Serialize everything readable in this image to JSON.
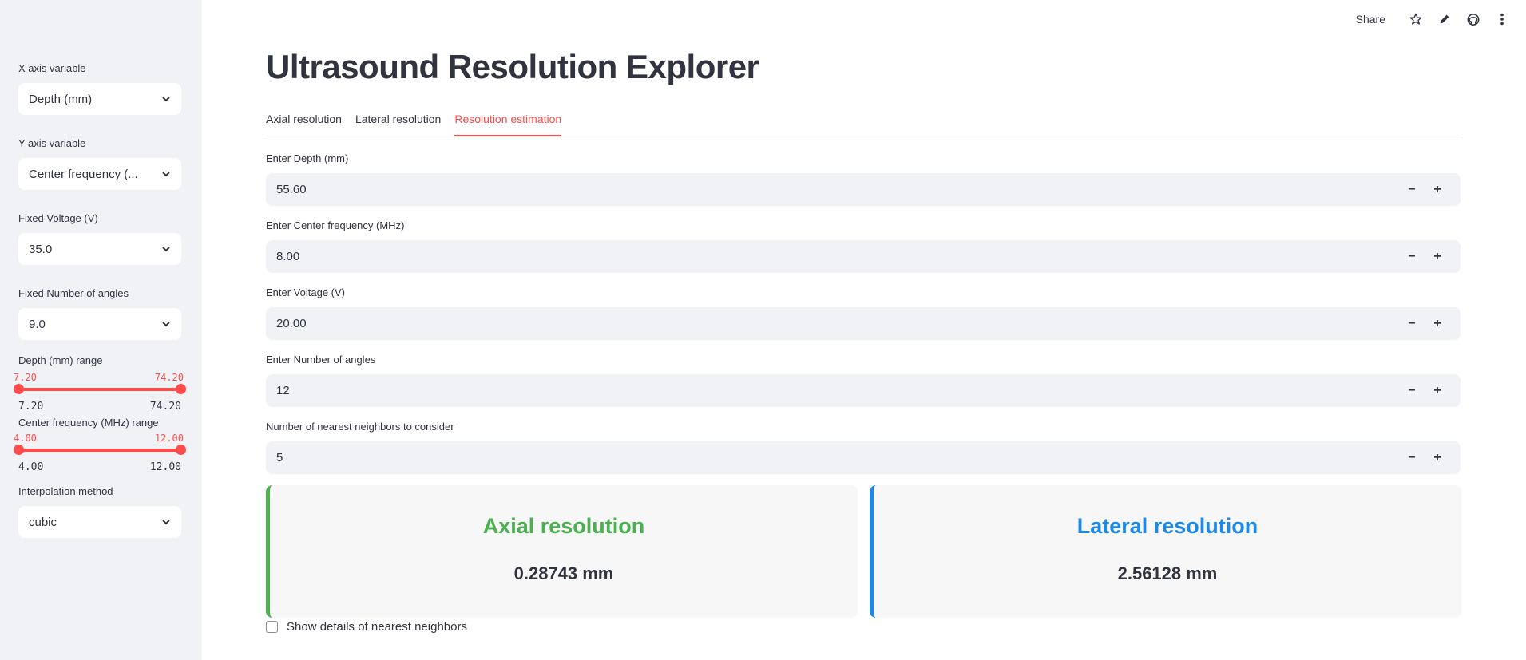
{
  "sidebar": {
    "x_axis": {
      "label": "X axis variable",
      "value": "Depth (mm)"
    },
    "y_axis": {
      "label": "Y axis variable",
      "value": "Center frequency (..."
    },
    "fixed_voltage": {
      "label": "Fixed Voltage (V)",
      "value": "35.0"
    },
    "fixed_angles": {
      "label": "Fixed Number of angles",
      "value": "9.0"
    },
    "depth_range": {
      "label": "Depth (mm) range",
      "low": "7.20",
      "high": "74.20",
      "min": "7.20",
      "max": "74.20"
    },
    "freq_range": {
      "label": "Center frequency (MHz) range",
      "low": "4.00",
      "high": "12.00",
      "min": "4.00",
      "max": "12.00"
    },
    "interp": {
      "label": "Interpolation method",
      "value": "cubic"
    }
  },
  "header": {
    "share_label": "Share",
    "icons": [
      "star-icon",
      "edit-icon",
      "github-icon",
      "more-vertical-icon"
    ]
  },
  "main": {
    "title": "Ultrasound Resolution Explorer",
    "tabs": [
      {
        "label": "Axial resolution",
        "active": false
      },
      {
        "label": "Lateral resolution",
        "active": false
      },
      {
        "label": "Resolution estimation",
        "active": true
      }
    ],
    "fields": [
      {
        "label": "Enter Depth (mm)",
        "value": "55.60"
      },
      {
        "label": "Enter Center frequency (MHz)",
        "value": "8.00"
      },
      {
        "label": "Enter Voltage (V)",
        "value": "20.00"
      },
      {
        "label": "Enter Number of angles",
        "value": "12"
      },
      {
        "label": "Number of nearest neighbors to consider",
        "value": "5"
      }
    ],
    "step_minus": "−",
    "step_plus": "+",
    "results": {
      "axial": {
        "title": "Axial resolution",
        "value": "0.28743 mm",
        "color": "#4caf50"
      },
      "lateral": {
        "title": "Lateral resolution",
        "value": "2.56128 mm",
        "color": "#1e88e5"
      }
    },
    "checkbox_label": "Show details of nearest neighbors"
  },
  "colors": {
    "accent": "#ff4b4b",
    "sidebar_bg": "#f0f2f6"
  }
}
